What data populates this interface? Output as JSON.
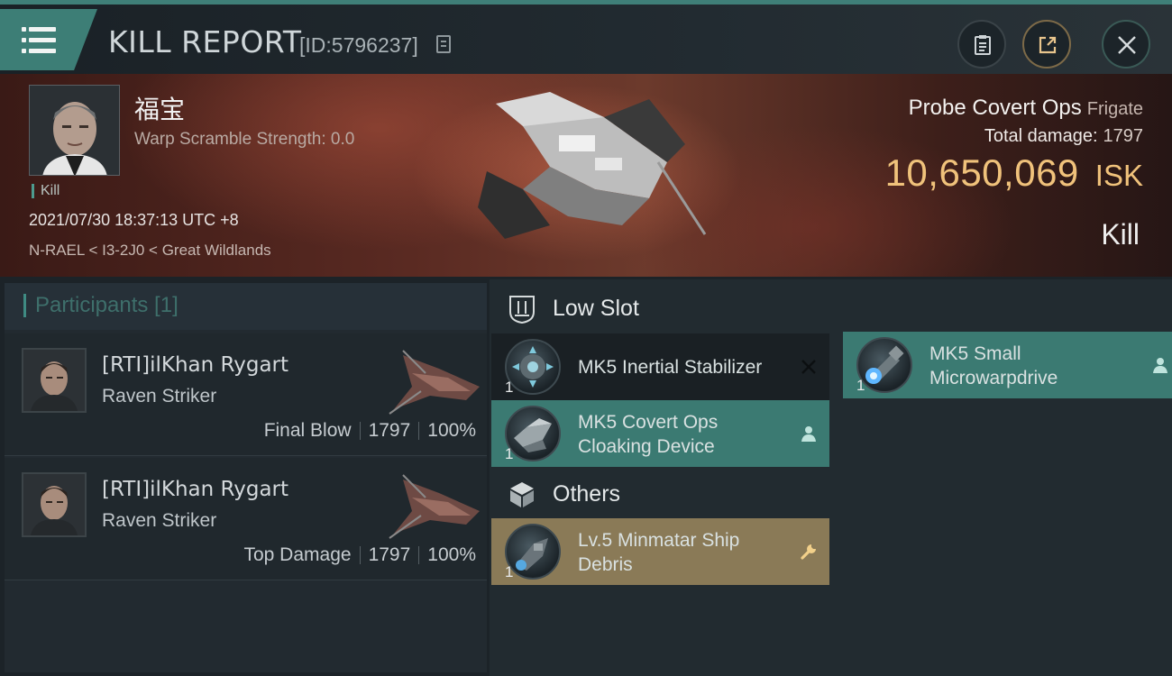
{
  "header": {
    "title": "KILL REPORT",
    "report_id": "[ID:5796237]",
    "menu_icon": "hamburger-menu-icon",
    "actions": [
      "clipboard-icon",
      "share-icon",
      "close-icon"
    ]
  },
  "victim": {
    "name": "福宝",
    "warp_scramble": "Warp Scramble Strength: 0.0",
    "tag": "Kill",
    "datetime": "2021/07/30 18:37:13 UTC +8",
    "location": "N-RAEL < I3-2J0 < Great Wildlands",
    "ship_name": "Probe Covert Ops",
    "ship_class": "Frigate",
    "total_damage_label": "Total damage:",
    "total_damage": "1797",
    "isk_value": "10,650,069",
    "isk_unit": "ISK",
    "result": "Kill"
  },
  "participants": {
    "title": "Participants [1]",
    "cards": [
      {
        "name": "[RTI]ilKhan Rygart",
        "ship": "Raven Striker",
        "role": "Final Blow",
        "damage": "1797",
        "percent": "100%"
      },
      {
        "name": "[RTI]ilKhan Rygart",
        "ship": "Raven Striker",
        "role": "Top Damage",
        "damage": "1797",
        "percent": "100%"
      }
    ]
  },
  "modules": {
    "low_slot_label": "Low Slot",
    "others_label": "Others",
    "items": [
      {
        "name": "MK5 Inertial Stabilizer",
        "qty": "1",
        "status": "destroyed-x-icon"
      },
      {
        "name_line1": "MK5 Small",
        "name_line2": "Microwarpdrive",
        "qty": "1",
        "status": "dropped-person-icon"
      },
      {
        "name_line1": "MK5 Covert Ops",
        "name_line2": "Cloaking Device",
        "qty": "1",
        "status": "dropped-person-icon"
      },
      {
        "name_line1": "Lv.5 Minmatar Ship",
        "name_line2": "Debris",
        "qty": "1",
        "status": "wrench-icon"
      }
    ]
  },
  "colors": {
    "accent_teal": "#3d7e76",
    "isk_gold": "#f0c27b",
    "dropped_bg": "#3b7a72",
    "debris_bg": "#8a7a57"
  }
}
